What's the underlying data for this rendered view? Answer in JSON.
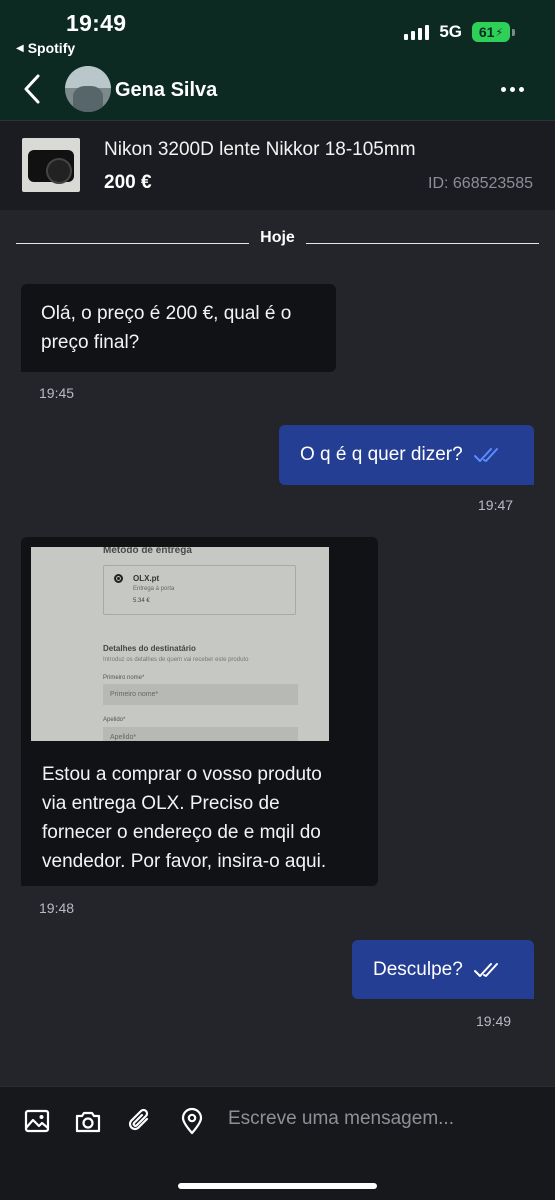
{
  "status_bar": {
    "time": "19:49",
    "back_app": "Spotify",
    "network": "5G",
    "battery": "61"
  },
  "header": {
    "contact_name": "Gena Silva"
  },
  "listing": {
    "title": "Nikon 3200D lente Nikkor 18-105mm",
    "price": "200 €",
    "id": "ID: 668523585"
  },
  "day_separator": "Hoje",
  "messages": [
    {
      "direction": "in",
      "text_lines": [
        "Olá, o preço é 200 €, qual é o",
        "preço final?"
      ],
      "time": "19:45"
    },
    {
      "direction": "out",
      "text": "O q é q quer dizer?",
      "time": "19:47",
      "status": "read"
    },
    {
      "direction": "in",
      "has_image": true,
      "text_lines": [
        "Estou a comprar o vosso produto",
        "via entrega OLX. Preciso de",
        "fornecer o endereço de e mqil do",
        "vendedor. Por favor, insira-o aqui."
      ],
      "time": "19:48"
    },
    {
      "direction": "out",
      "text": "Desculpe?",
      "time": "19:49",
      "status": "delivered"
    }
  ],
  "attached_screenshot": {
    "heading": "Método de entrega",
    "option_name": "OLX.pt",
    "option_detail": "Entrega à porta",
    "option_price": "5.34 €",
    "section_title": "Detalhes do destinatário",
    "section_subtitle": "Introduz os detalhes de quem vai receber este produto",
    "field1_label": "Primeiro nome*",
    "field1_placeholder": "Primeiro nome*",
    "field2_label": "Apelido*",
    "field2_placeholder": "Apelido*"
  },
  "composer": {
    "placeholder": "Escreve uma mensagem...",
    "icons": [
      "image-icon",
      "camera-icon",
      "attachment-icon",
      "location-icon"
    ]
  },
  "colors": {
    "header_bg": "#0d2a22",
    "chat_bg": "#23252b",
    "incoming_bubble": "#101216",
    "outgoing_bubble": "#243e93",
    "read_tick": "#5b8cff"
  }
}
